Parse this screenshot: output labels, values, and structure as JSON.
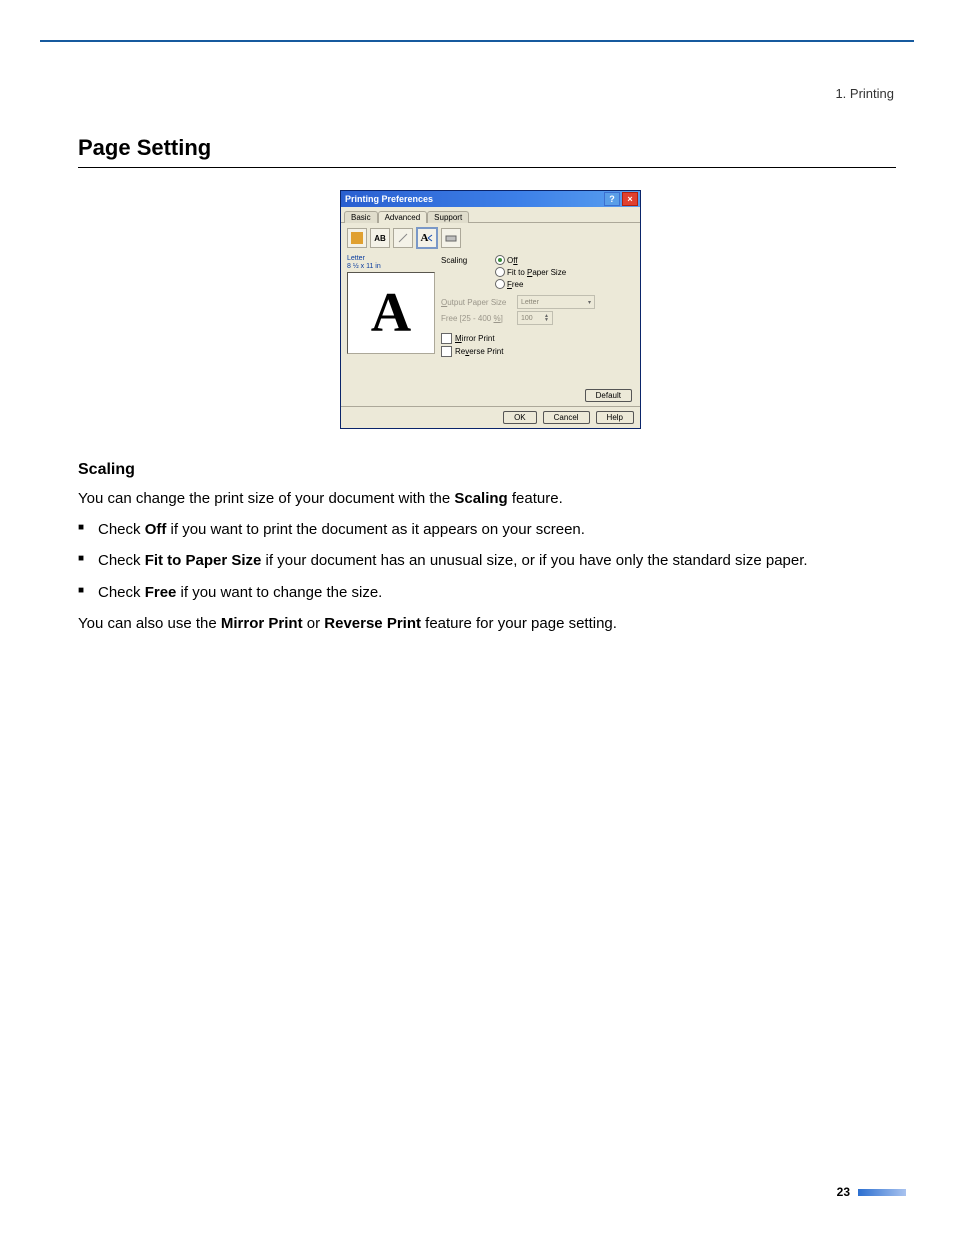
{
  "chapter": {
    "label": "1. Printing"
  },
  "section": {
    "title": "Page Setting"
  },
  "dialog": {
    "title": "Printing Preferences",
    "help_btn": "?",
    "close_btn": "×",
    "tabs": {
      "basic": "Basic",
      "advanced": "Advanced",
      "support": "Support"
    },
    "toolbar": {
      "btn2": "AB",
      "btn4": "A"
    },
    "preview": {
      "paper_name": "Letter",
      "paper_dim": "8 ½ x 11 in",
      "glyph": "A"
    },
    "scaling": {
      "label": "Scaling",
      "opt_off_plain": "O",
      "opt_off_u": "ff",
      "opt_fit_pre": "Fit to ",
      "opt_fit_u": "P",
      "opt_fit_post": "aper Size",
      "opt_free_u": "F",
      "opt_free_post": "ree",
      "output_u": "O",
      "output_post": "utput Paper Size",
      "output_value": "Letter",
      "free_pre": "Free [25 - 400 ",
      "free_u": "%",
      "free_post": "]",
      "free_value": "100"
    },
    "mirror_u": "M",
    "mirror_post": "irror Print",
    "reverse_pre": "Re",
    "reverse_u": "v",
    "reverse_post": "erse Print",
    "buttons": {
      "default": "Default",
      "ok": "OK",
      "cancel": "Cancel",
      "help": "Help"
    }
  },
  "body": {
    "h_scaling": "Scaling",
    "p_intro_pre": "You can change the print size of your document with the ",
    "p_intro_b": "Scaling",
    "p_intro_post": " feature.",
    "li1_pre": "Check ",
    "li1_b": "Off",
    "li1_post": " if you want to print the document as it appears on your screen.",
    "li2_pre": "Check ",
    "li2_b": "Fit to Paper Size",
    "li2_post": " if your document has an unusual size, or if you have only the standard size paper.",
    "li3_pre": "Check ",
    "li3_b": "Free",
    "li3_post": " if you want to change the size.",
    "p_also_pre": "You can also use the ",
    "p_also_b1": "Mirror Print",
    "p_also_mid": " or ",
    "p_also_b2": "Reverse Print",
    "p_also_post": " feature for your page setting."
  },
  "footer": {
    "page_number": "23"
  }
}
